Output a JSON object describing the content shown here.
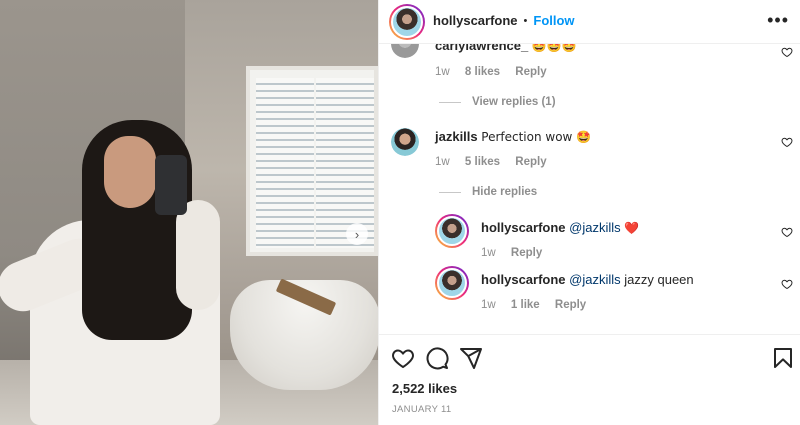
{
  "post": {
    "author": "hollyscarfone",
    "separator": "•",
    "follow_label": "Follow",
    "more_label": "•••",
    "next_label": "›"
  },
  "comments": [
    {
      "username": "carlylawrence_",
      "text": "🤩🤩🤩",
      "age": "1w",
      "likes": "8 likes",
      "reply_label": "Reply",
      "replies_toggle": "View replies (1)"
    },
    {
      "username": "jazkills",
      "text": "Perfection wow 🤩",
      "age": "1w",
      "likes": "5 likes",
      "reply_label": "Reply",
      "replies_toggle": "Hide replies",
      "replies": [
        {
          "username": "hollyscarfone",
          "mention": "@jazkills",
          "text": "❤️",
          "age": "1w",
          "reply_label": "Reply"
        },
        {
          "username": "hollyscarfone",
          "mention": "@jazkills",
          "text": "jazzy queen",
          "age": "1w",
          "likes": "1 like",
          "reply_label": "Reply"
        }
      ]
    }
  ],
  "footer": {
    "likes": "2,522 likes",
    "date": "JANUARY 11"
  },
  "colors": {
    "accent": "#0095f6",
    "muted": "#8e8e8e",
    "text": "#262626",
    "heart_red": "#ed4956"
  },
  "icons": [
    "heart-icon",
    "comment-icon",
    "share-icon",
    "bookmark-icon",
    "more-icon",
    "chevron-right-icon"
  ]
}
